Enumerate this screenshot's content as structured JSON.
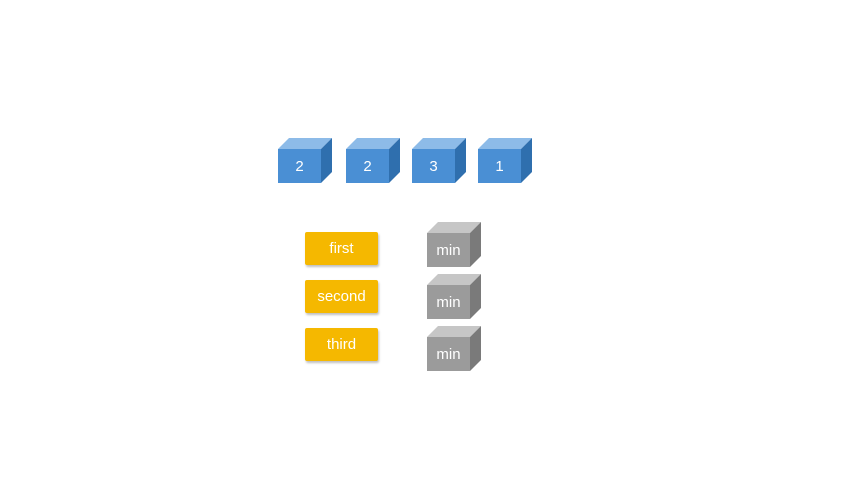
{
  "colors": {
    "blue_front": "#4a8fd4",
    "blue_top": "#8dbbe8",
    "blue_side": "#2f6fae",
    "gray_front": "#9b9b9b",
    "gray_top": "#c6c6c6",
    "gray_side": "#7a7a7a",
    "tag_fill": "#f5b800",
    "text": "#ffffff"
  },
  "top_row": {
    "values": [
      "2",
      "2",
      "3",
      "1"
    ]
  },
  "tags": {
    "labels": [
      "first",
      "second",
      "third"
    ]
  },
  "min_boxes": {
    "labels": [
      "min",
      "min",
      "min"
    ]
  }
}
